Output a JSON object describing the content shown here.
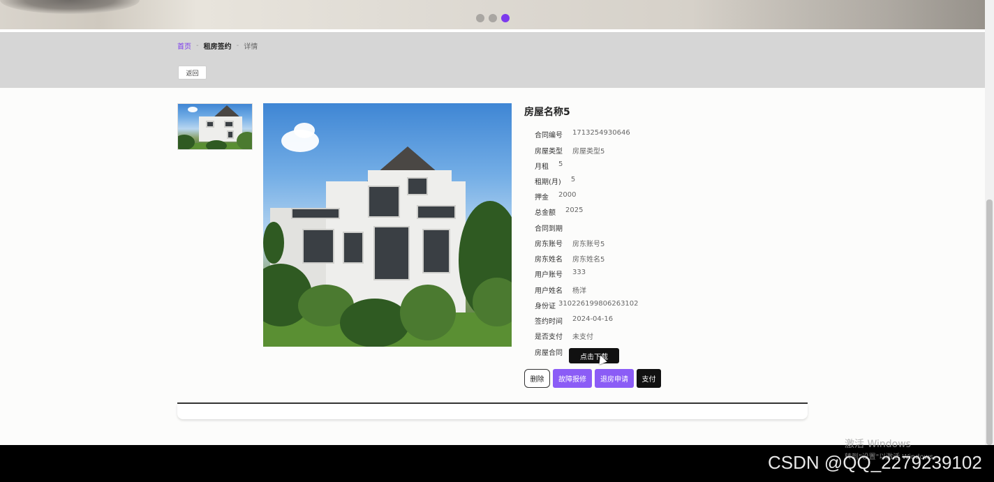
{
  "carousel": {
    "dot_count": 3,
    "active_index": 2,
    "active_color": "#7c3aed"
  },
  "breadcrumb": {
    "home": "首页",
    "separator": "-",
    "section": "租房签约",
    "current": "详情"
  },
  "back_button": "返回",
  "house": {
    "title": "房屋名称5",
    "details": [
      {
        "label": "合同编号",
        "value": "1713254930646"
      },
      {
        "label": "房屋类型",
        "value": "房屋类型5"
      },
      {
        "label": "月租",
        "value": "5"
      },
      {
        "label": "租期(月)",
        "value": "5"
      },
      {
        "label": "押金",
        "value": "2000"
      },
      {
        "label": "总金额",
        "value": "2025"
      },
      {
        "label": "合同到期",
        "value": ""
      },
      {
        "label": "房东账号",
        "value": "房东账号5"
      },
      {
        "label": "房东姓名",
        "value": "房东姓名5"
      },
      {
        "label": "用户账号",
        "value": "333"
      },
      {
        "label": "用户姓名",
        "value": "杨洋"
      },
      {
        "label": "身份证",
        "value": "310226199806263102"
      },
      {
        "label": "签约时间",
        "value": "2024-04-16"
      },
      {
        "label": "是否支付",
        "value": "未支付"
      }
    ],
    "contract_label": "房屋合同",
    "download_button": "点击下载"
  },
  "actions": {
    "delete": "删除",
    "repair": "故障报修",
    "checkout": "退房申请",
    "pay": "支付"
  },
  "colors": {
    "accent": "#8b5cf6",
    "brand": "#7c3aed",
    "footer": "#000000"
  },
  "overlay": {
    "activate_title": "激活 Windows",
    "activate_hint": "转到\"设置\"以激活 Windows。",
    "watermark": "CSDN @QQ_2279239102"
  }
}
